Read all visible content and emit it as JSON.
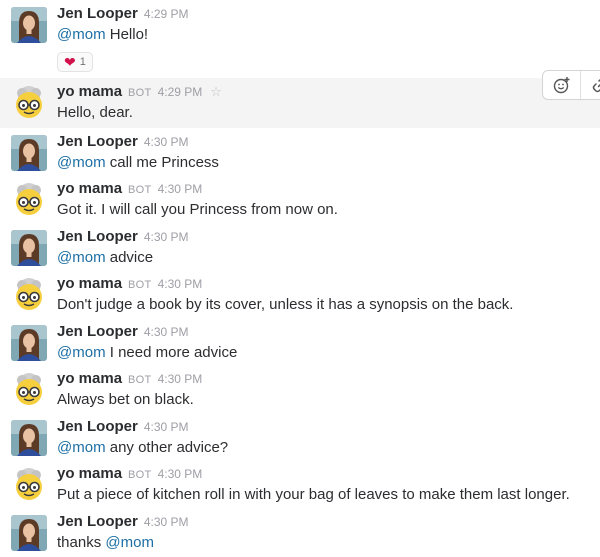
{
  "users": {
    "jen": {
      "name": "Jen Looper"
    },
    "mama": {
      "name": "yo mama",
      "badge": "BOT"
    }
  },
  "mention": "@mom",
  "messages": [
    {
      "time": "4:29 PM",
      "text": "Hello!",
      "reaction": {
        "icon": "heart-icon",
        "count": "1"
      }
    },
    {
      "time": "4:29 PM",
      "text": "Hello, dear."
    },
    {
      "time": "4:30 PM",
      "text": "call me Princess"
    },
    {
      "time": "4:30 PM",
      "text": "Got it. I will call you Princess from now on."
    },
    {
      "time": "4:30 PM",
      "text": "advice"
    },
    {
      "time": "4:30 PM",
      "text": "Don't judge a book by its cover, unless it has a synopsis on the back."
    },
    {
      "time": "4:30 PM",
      "text": "I need more advice"
    },
    {
      "time": "4:30 PM",
      "text": "Always bet on black."
    },
    {
      "time": "4:30 PM",
      "text": "any other advice?"
    },
    {
      "time": "4:30 PM",
      "text": "Put a piece of kitchen roll in with your bag of leaves to make them last longer."
    },
    {
      "time": "4:30 PM",
      "text": "thanks"
    }
  ],
  "hover_actions": [
    "add-reaction-icon",
    "link-icon"
  ],
  "colors": {
    "mention": "#1d6fa5",
    "hover_bg": "#f4f4f4",
    "heart": "#d2114c"
  }
}
